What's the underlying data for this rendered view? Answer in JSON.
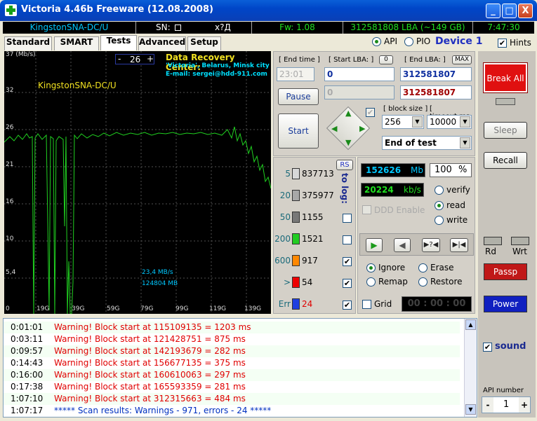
{
  "window": {
    "title": "Victoria 4.46b Freeware (12.08.2008)",
    "min": "_",
    "max": "□",
    "close": "X"
  },
  "infobar": {
    "drive": "KingstonSNA-DC/U",
    "sn_label": "SN:",
    "sn_value": "x?Д",
    "fw": "Fw: 1.08",
    "lba": "312581808 LBA (~149 GB)",
    "time": "7:47:30"
  },
  "mode": {
    "api": "API",
    "pio": "PIO",
    "device": "Device 1",
    "hints": "Hints"
  },
  "tabs": [
    "Standard",
    "SMART",
    "Tests",
    "Advanced",
    "Setup"
  ],
  "graph": {
    "yticks": [
      "37 (Mb/s)",
      "32",
      "26",
      "21",
      "16",
      "10",
      "5,4",
      "0"
    ],
    "xticks": [
      "19G",
      "39G",
      "59G",
      "79G",
      "99G",
      "119G",
      "139G"
    ],
    "drive_label": "KingstonSNA-DC/U",
    "counter": "26",
    "minus": "-",
    "plus": "+",
    "drc_title": "Data Recovery Center:",
    "drc_line1": "'Victoria', Belarus, Minsk city",
    "drc_line2": "E-mail: sergei@hdd-911.com",
    "speed": "23,4 MB/s",
    "position": "124804 MB"
  },
  "controls": {
    "end_time_label": "[ End time ]",
    "end_time_value": "23:01",
    "start_lba_label": "[ Start LBA: ]",
    "start_lba_zero": "0",
    "start_lba_value": "0",
    "start_lba_value2": "0",
    "end_lba_label": "[ End LBA: ]",
    "end_lba_max": "MAX",
    "end_lba_value": "312581807",
    "end_lba_value2": "312581807",
    "pause": "Pause",
    "start": "Start",
    "block_size_label": "[ block size ]",
    "block_size": "256",
    "timeout_label": "[ timeout,ms ]",
    "timeout": "10000",
    "end_action": "End of test"
  },
  "blocks": {
    "rs": "RS",
    "to_log": "to log:",
    "rows": [
      {
        "label": "5",
        "count": "837713",
        "color": "#d8d8d8",
        "checked": ""
      },
      {
        "label": "20",
        "count": "375977",
        "color": "#a8a8a8",
        "checked": ""
      },
      {
        "label": "50",
        "count": "1155",
        "color": "#787878",
        "checked": ""
      },
      {
        "label": "200",
        "count": "1521",
        "color": "#22cc22",
        "checked": ""
      },
      {
        "label": "600",
        "count": "917",
        "color": "#ff8800",
        "checked": "✔"
      },
      {
        "label": ">",
        "count": "54",
        "color": "#ee0000",
        "checked": "✔"
      },
      {
        "label": "Err",
        "count": "24",
        "color": "#2040e0",
        "checked": "✔"
      }
    ]
  },
  "stats": {
    "mb": "152626",
    "mb_unit": "Mb",
    "percent": "100",
    "percent_unit": "%",
    "kbs": "20224",
    "kbs_unit": "kb/s",
    "ddd": "DDD Enable",
    "verify": "verify",
    "read": "read",
    "write": "write",
    "ignore": "Ignore",
    "erase": "Erase",
    "remap": "Remap",
    "restore": "Restore",
    "grid": "Grid",
    "timer": "00 : 00 : 00"
  },
  "side": {
    "break_all": "Break All",
    "sleep": "Sleep",
    "recall": "Recall",
    "rd": "Rd",
    "wrt": "Wrt",
    "passp": "Passp",
    "power": "Power",
    "sound": "sound",
    "api_number_label": "API number",
    "api_number": "1",
    "api_minus": "-",
    "api_plus": "+"
  },
  "log": [
    {
      "time": "0:01:01",
      "msg": "Warning! Block start at 115109135 = 1203 ms",
      "kind": "warn"
    },
    {
      "time": "0:03:11",
      "msg": "Warning! Block start at 121428751 = 875 ms",
      "kind": "warn"
    },
    {
      "time": "0:09:57",
      "msg": "Warning! Block start at 142193679 = 282 ms",
      "kind": "warn"
    },
    {
      "time": "0:14:43",
      "msg": "Warning! Block start at 156677135 = 375 ms",
      "kind": "warn"
    },
    {
      "time": "0:16:00",
      "msg": "Warning! Block start at 160610063 = 297 ms",
      "kind": "warn"
    },
    {
      "time": "0:17:38",
      "msg": "Warning! Block start at 165593359 = 281 ms",
      "kind": "warn"
    },
    {
      "time": "1:07:10",
      "msg": "Warning! Block start at 312315663 = 484 ms",
      "kind": "warn"
    },
    {
      "time": "1:07:17",
      "msg": "***** Scan results: Warnings - 971, errors - 24 *****",
      "kind": "info"
    }
  ],
  "colors": {
    "lcd_cyan": "#00c8ff",
    "lcd_green": "#20e020",
    "warn": "#e00000",
    "info": "#0030c0",
    "graph_line": "#20d020"
  }
}
